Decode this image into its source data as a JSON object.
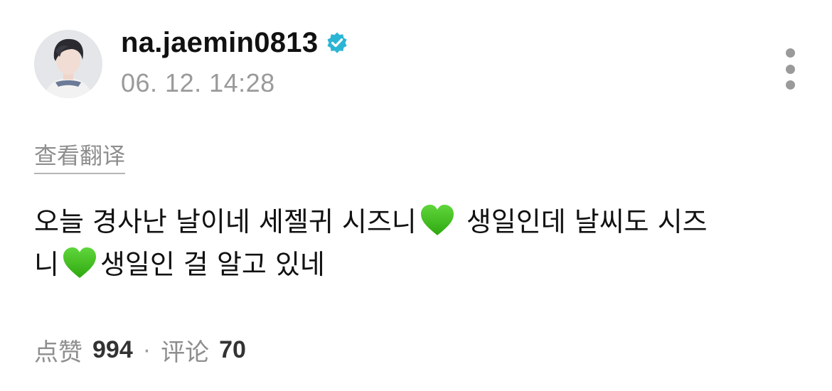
{
  "profile": {
    "username": "na.jaemin0813",
    "timestamp": "06. 12. 14:28"
  },
  "post": {
    "translate_label": "查看翻译",
    "text_line1_part1": "오늘 경사난 날이네 세젤귀 시즈니",
    "text_line1_part2": " 생일인데 날씨도 시즈",
    "text_line2_part1": "니",
    "text_line2_part2": "생일인 걸 알고 있네"
  },
  "stats": {
    "likes_label": "点赞",
    "likes_count": "994",
    "separator": "·",
    "comments_label": "评论",
    "comments_count": "70"
  },
  "icons": {
    "verified": "verified-badge-icon",
    "more": "more-vertical-icon",
    "heart": "green-heart-emoji"
  },
  "colors": {
    "verified_badge": "#2bb5d4",
    "green_heart": "#3bbf16",
    "muted_text": "#8e8e8e"
  }
}
